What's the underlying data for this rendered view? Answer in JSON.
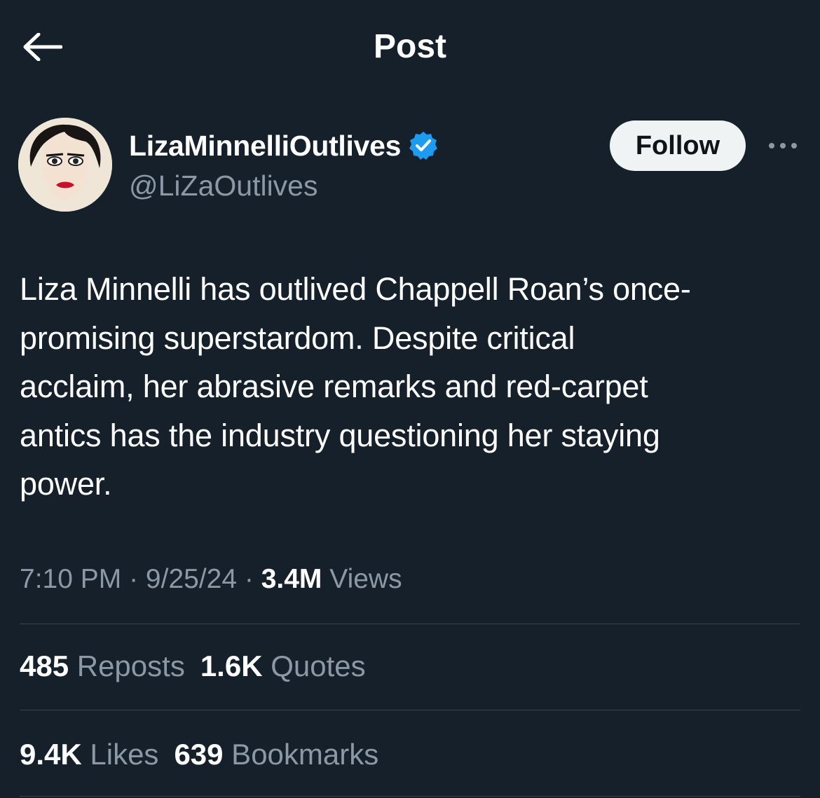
{
  "header": {
    "title": "Post",
    "back_icon": "arrow-left-icon"
  },
  "author": {
    "display_name": "LizaMinnelliOutlives",
    "handle": "@LiZaOutlives",
    "verified_icon": "verified-badge-icon",
    "verified_color": "#1d9bf0"
  },
  "follow_label": "Follow",
  "more_icon": "more-options-icon",
  "post": {
    "text": "Liza Minnelli has outlived Chappell Roan’s once-\npromising superstardom. Despite critical\nacclaim, her abrasive remarks and red-carpet\nantics has the industry questioning her staying\npower."
  },
  "meta": {
    "time": "7:10 PM",
    "sep1": " · ",
    "date": "9/25/24",
    "sep2": " · ",
    "views_count": "3.4M",
    "views_label": " Views"
  },
  "stats": {
    "reposts_count": "485",
    "reposts_label": " Reposts",
    "quotes_count": "1.6K",
    "quotes_label": " Quotes",
    "likes_count": "9.4K",
    "likes_label": " Likes",
    "bookmarks_count": "639",
    "bookmarks_label": " Bookmarks"
  },
  "colors": {
    "background": "#15202b",
    "text_primary": "#ffffff",
    "text_secondary": "#8b98a5",
    "divider": "#38444d",
    "follow_bg": "#eff3f4"
  }
}
